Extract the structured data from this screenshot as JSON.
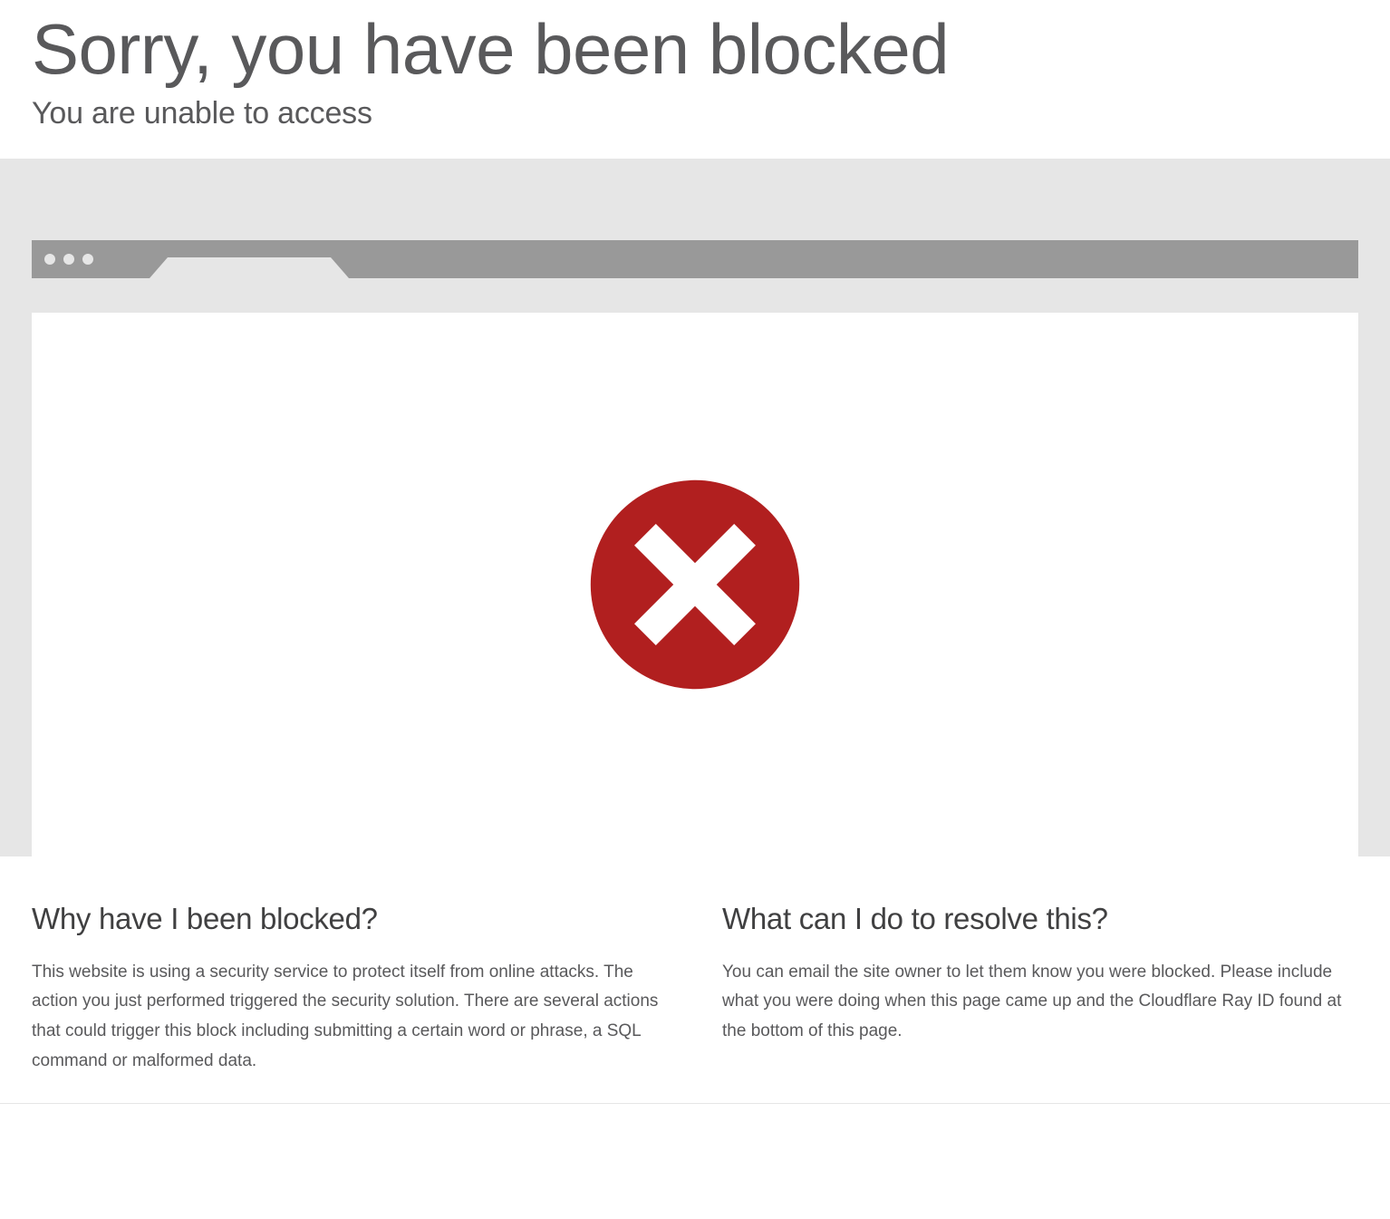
{
  "header": {
    "title": "Sorry, you have been blocked",
    "subtitle": "You are unable to access"
  },
  "info": {
    "left": {
      "heading": "Why have I been blocked?",
      "body": "This website is using a security service to protect itself from online attacks. The action you just performed triggered the security solution. There are several actions that could trigger this block including submitting a certain word or phrase, a SQL command or malformed data."
    },
    "right": {
      "heading": "What can I do to resolve this?",
      "body": "You can email the site owner to let them know you were blocked. Please include what you were doing when this page came up and the Cloudflare Ray ID found at the bottom of this page."
    }
  },
  "colors": {
    "error": "#b11f1f",
    "chrome": "#999999",
    "band": "#e6e6e6"
  }
}
